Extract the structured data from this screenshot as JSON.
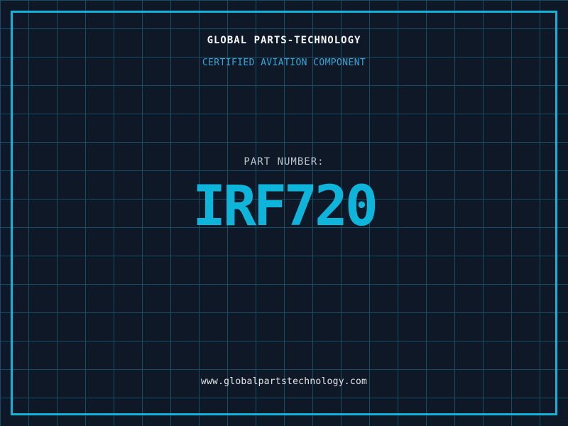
{
  "header": {
    "company": "GLOBAL PARTS-TECHNOLOGY",
    "tagline": "CERTIFIED AVIATION COMPONENT"
  },
  "part": {
    "label": "PART NUMBER:",
    "number": "IRF720"
  },
  "footer": {
    "website": "www.globalpartstechnology.com"
  },
  "colors": {
    "background": "#0f1827",
    "grid_line": "#1a4d64",
    "frame_border": "#12b1d8",
    "accent_cyan": "#0db5da",
    "tagline_blue": "#2fa7d7",
    "muted_gray": "#b9c3cc",
    "text_white": "#f4f6f8"
  }
}
